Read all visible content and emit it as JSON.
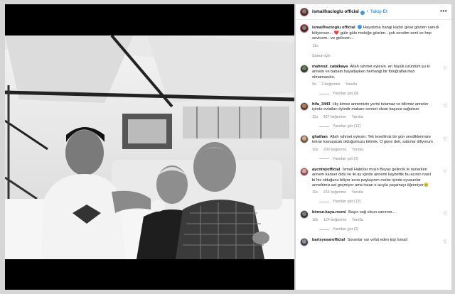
{
  "post": {
    "username": "ismailhacioglu official",
    "follow_label": "Takip Et",
    "more_label": "•••",
    "caption_user": "ismailhacioglu official",
    "caption_text": "Hayatıma hangi kadın girse gözlen sanıdı biliyorsun... ❤️ güle güle meleğe gözüm...çok sevdim seni ve hep sevicem...ve gelicem...",
    "caption_time": "11s",
    "translate_label": "Şunun için"
  },
  "comments": [
    {
      "user": "mahmut_catalkaya",
      "text": "Allah rahmet eylesin. en büyük üzüntüm şu ki annem ve babam hayattayken herhangi bir fotoğraflarımızı olmamasıdır.",
      "time": "9s",
      "likes": "2 beğenme",
      "reply": "Yanıtla",
      "replies": "Yanıtları gör (9)"
    },
    {
      "user": "hifa_3443",
      "text": "Hiç kimse annemizin yerini tutamaz ve bilirmiz anneler içinde evlatları öyledir makanı cennet olsun başınız sağolsun",
      "time": "11s",
      "likes": "327 beğenme",
      "reply": "Yanıtla",
      "replies": "Yanıtları gör (12)"
    },
    {
      "user": "ghathan",
      "text": "Allah rahmet eylesin. Tek tesellimiz bir gün sevdiklerimize tekrar kavuşacak olduğumuzu bilmek. O güne dek, sabırlar diliyorum",
      "time": "10s",
      "likes": "200 beğenme",
      "reply": "Yanıtla",
      "replies": "Yanıtları gör (2)"
    },
    {
      "user": "aycntnyofficial",
      "text": "İsmail Habirlar mısın Beyaz gelincik te oynarken annem kanser oldu ve iki ay içinde annemi kaybettik bu acının nasıl bi his olduğunu biliyor acını paylaşırım nurlar içinde uyusunlar annelrimiz.asi geçmiyor ama insan o acıyla yaşamayı öğreniyor😢",
      "time": "11s",
      "likes": "153 beğenme",
      "reply": "Yanıtla",
      "replies": "Yanıtları gör (13)"
    },
    {
      "user": "binnur.kaya.resmi",
      "text": "Başın sağ olsun canımm...",
      "time": "10s",
      "likes": "124 beğenme",
      "reply": "Yanıtla",
      "replies": "Yanıtları gör (2)"
    },
    {
      "user": "barisyesarofficial",
      "text": "Sorantar var vefat eden kişi İsmail",
      "time": "",
      "likes": "",
      "reply": "",
      "replies": ""
    }
  ],
  "colors": {
    "link": "#3897f0",
    "muted": "#888888",
    "story_ring": "#d04a7a"
  },
  "icons": [
    "heart-icon",
    "verified-icon",
    "more-icon"
  ]
}
